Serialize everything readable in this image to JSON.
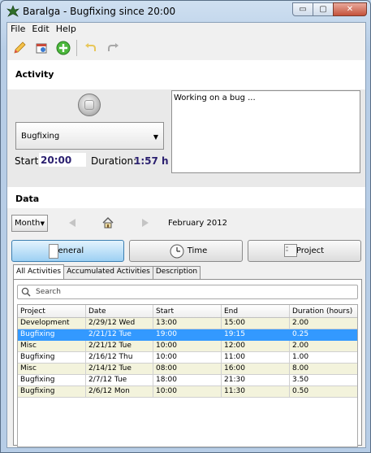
{
  "window": {
    "title": "Baralga - Bugfixing since 20:00",
    "controls": {
      "minimize": "▭",
      "maximize": "▢",
      "close": "✕"
    }
  },
  "menu": [
    "File",
    "Edit",
    "Help"
  ],
  "toolbar": {
    "buttons": [
      "pencil-icon",
      "calendar-icon",
      "add-icon",
      "undo-icon",
      "redo-icon"
    ]
  },
  "activity": {
    "heading": "Activity",
    "project": "Bugfixing",
    "start_label": "Start:",
    "start_value": "20:00",
    "duration_label": "Duration:",
    "duration_value": "1:57 h",
    "description": "Working on a bug ..."
  },
  "data": {
    "heading": "Data",
    "period_type": "Month",
    "period_label": "February 2012",
    "views": [
      "General",
      "Time",
      "Project"
    ],
    "tabs": [
      "All Activities",
      "Accumulated Activities",
      "Description"
    ],
    "search_placeholder": "Search",
    "columns": [
      "Project",
      "Date",
      "Start",
      "End",
      "Duration (hours)"
    ],
    "rows": [
      [
        "Development",
        "2/29/12 Wed",
        "13:00",
        "15:00",
        "2.00"
      ],
      [
        "Bugfixing",
        "2/21/12 Tue",
        "19:00",
        "19:15",
        "0.25"
      ],
      [
        "Misc",
        "2/21/12 Tue",
        "10:00",
        "12:00",
        "2.00"
      ],
      [
        "Bugfixing",
        "2/16/12 Thu",
        "10:00",
        "11:00",
        "1.00"
      ],
      [
        "Misc",
        "2/14/12 Tue",
        "08:00",
        "16:00",
        "8.00"
      ],
      [
        "Bugfixing",
        "2/7/12 Tue",
        "18:00",
        "21:30",
        "3.50"
      ],
      [
        "Bugfixing",
        "2/6/12 Mon",
        "10:00",
        "11:30",
        "0.50"
      ]
    ],
    "selected_row": 1
  },
  "colors": {
    "selection": "#3399ff",
    "accent_text": "#2a1f6f",
    "row_alt": "#f3f3dc"
  }
}
